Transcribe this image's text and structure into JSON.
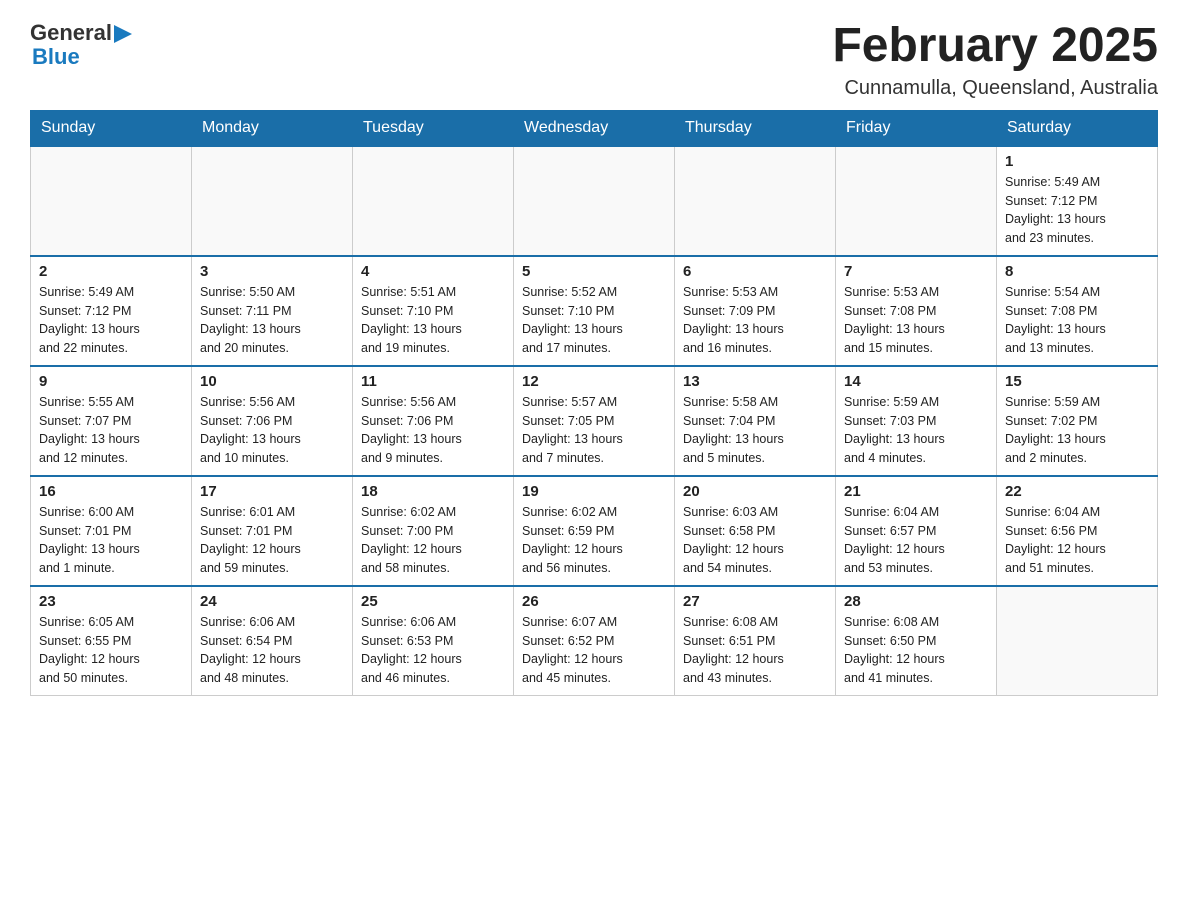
{
  "header": {
    "logo": {
      "general": "General",
      "arrow": "▶",
      "blue": "Blue"
    },
    "title": "February 2025",
    "location": "Cunnamulla, Queensland, Australia"
  },
  "calendar": {
    "days_of_week": [
      "Sunday",
      "Monday",
      "Tuesday",
      "Wednesday",
      "Thursday",
      "Friday",
      "Saturday"
    ],
    "weeks": [
      [
        {
          "day": "",
          "info": ""
        },
        {
          "day": "",
          "info": ""
        },
        {
          "day": "",
          "info": ""
        },
        {
          "day": "",
          "info": ""
        },
        {
          "day": "",
          "info": ""
        },
        {
          "day": "",
          "info": ""
        },
        {
          "day": "1",
          "info": "Sunrise: 5:49 AM\nSunset: 7:12 PM\nDaylight: 13 hours\nand 23 minutes."
        }
      ],
      [
        {
          "day": "2",
          "info": "Sunrise: 5:49 AM\nSunset: 7:12 PM\nDaylight: 13 hours\nand 22 minutes."
        },
        {
          "day": "3",
          "info": "Sunrise: 5:50 AM\nSunset: 7:11 PM\nDaylight: 13 hours\nand 20 minutes."
        },
        {
          "day": "4",
          "info": "Sunrise: 5:51 AM\nSunset: 7:10 PM\nDaylight: 13 hours\nand 19 minutes."
        },
        {
          "day": "5",
          "info": "Sunrise: 5:52 AM\nSunset: 7:10 PM\nDaylight: 13 hours\nand 17 minutes."
        },
        {
          "day": "6",
          "info": "Sunrise: 5:53 AM\nSunset: 7:09 PM\nDaylight: 13 hours\nand 16 minutes."
        },
        {
          "day": "7",
          "info": "Sunrise: 5:53 AM\nSunset: 7:08 PM\nDaylight: 13 hours\nand 15 minutes."
        },
        {
          "day": "8",
          "info": "Sunrise: 5:54 AM\nSunset: 7:08 PM\nDaylight: 13 hours\nand 13 minutes."
        }
      ],
      [
        {
          "day": "9",
          "info": "Sunrise: 5:55 AM\nSunset: 7:07 PM\nDaylight: 13 hours\nand 12 minutes."
        },
        {
          "day": "10",
          "info": "Sunrise: 5:56 AM\nSunset: 7:06 PM\nDaylight: 13 hours\nand 10 minutes."
        },
        {
          "day": "11",
          "info": "Sunrise: 5:56 AM\nSunset: 7:06 PM\nDaylight: 13 hours\nand 9 minutes."
        },
        {
          "day": "12",
          "info": "Sunrise: 5:57 AM\nSunset: 7:05 PM\nDaylight: 13 hours\nand 7 minutes."
        },
        {
          "day": "13",
          "info": "Sunrise: 5:58 AM\nSunset: 7:04 PM\nDaylight: 13 hours\nand 5 minutes."
        },
        {
          "day": "14",
          "info": "Sunrise: 5:59 AM\nSunset: 7:03 PM\nDaylight: 13 hours\nand 4 minutes."
        },
        {
          "day": "15",
          "info": "Sunrise: 5:59 AM\nSunset: 7:02 PM\nDaylight: 13 hours\nand 2 minutes."
        }
      ],
      [
        {
          "day": "16",
          "info": "Sunrise: 6:00 AM\nSunset: 7:01 PM\nDaylight: 13 hours\nand 1 minute."
        },
        {
          "day": "17",
          "info": "Sunrise: 6:01 AM\nSunset: 7:01 PM\nDaylight: 12 hours\nand 59 minutes."
        },
        {
          "day": "18",
          "info": "Sunrise: 6:02 AM\nSunset: 7:00 PM\nDaylight: 12 hours\nand 58 minutes."
        },
        {
          "day": "19",
          "info": "Sunrise: 6:02 AM\nSunset: 6:59 PM\nDaylight: 12 hours\nand 56 minutes."
        },
        {
          "day": "20",
          "info": "Sunrise: 6:03 AM\nSunset: 6:58 PM\nDaylight: 12 hours\nand 54 minutes."
        },
        {
          "day": "21",
          "info": "Sunrise: 6:04 AM\nSunset: 6:57 PM\nDaylight: 12 hours\nand 53 minutes."
        },
        {
          "day": "22",
          "info": "Sunrise: 6:04 AM\nSunset: 6:56 PM\nDaylight: 12 hours\nand 51 minutes."
        }
      ],
      [
        {
          "day": "23",
          "info": "Sunrise: 6:05 AM\nSunset: 6:55 PM\nDaylight: 12 hours\nand 50 minutes."
        },
        {
          "day": "24",
          "info": "Sunrise: 6:06 AM\nSunset: 6:54 PM\nDaylight: 12 hours\nand 48 minutes."
        },
        {
          "day": "25",
          "info": "Sunrise: 6:06 AM\nSunset: 6:53 PM\nDaylight: 12 hours\nand 46 minutes."
        },
        {
          "day": "26",
          "info": "Sunrise: 6:07 AM\nSunset: 6:52 PM\nDaylight: 12 hours\nand 45 minutes."
        },
        {
          "day": "27",
          "info": "Sunrise: 6:08 AM\nSunset: 6:51 PM\nDaylight: 12 hours\nand 43 minutes."
        },
        {
          "day": "28",
          "info": "Sunrise: 6:08 AM\nSunset: 6:50 PM\nDaylight: 12 hours\nand 41 minutes."
        },
        {
          "day": "",
          "info": ""
        }
      ]
    ]
  }
}
